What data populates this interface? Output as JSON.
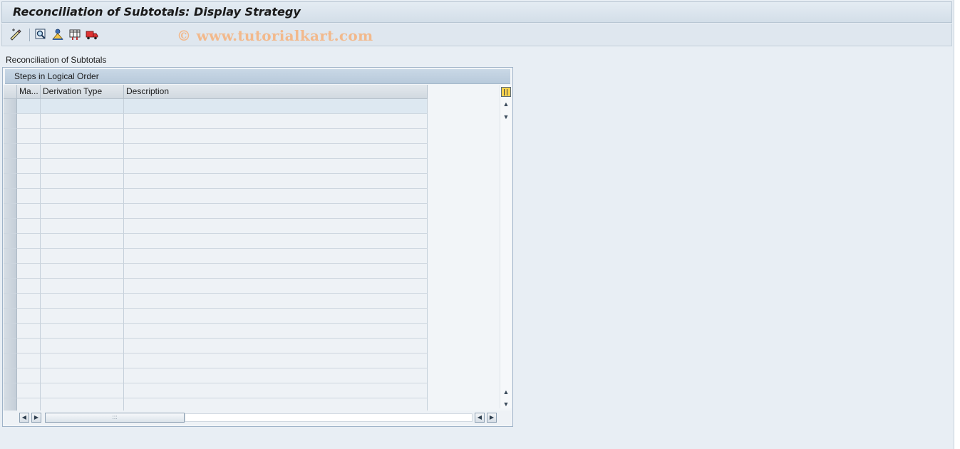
{
  "window": {
    "title": "Reconciliation of Subtotals: Display Strategy"
  },
  "toolbar": {
    "buttons": [
      {
        "name": "display-change-icon"
      },
      {
        "name": "find-icon"
      },
      {
        "name": "hierarchy-icon"
      },
      {
        "name": "overview-icon"
      },
      {
        "name": "transport-icon"
      }
    ]
  },
  "watermark": "© www.tutorialkart.com",
  "section": {
    "label": "Reconciliation of Subtotals"
  },
  "table": {
    "title": "Steps in Logical Order",
    "columns": [
      "Ma...",
      "Derivation Type",
      "Description"
    ],
    "rows": [
      [
        "",
        "",
        ""
      ],
      [
        "",
        "",
        ""
      ],
      [
        "",
        "",
        ""
      ],
      [
        "",
        "",
        ""
      ],
      [
        "",
        "",
        ""
      ],
      [
        "",
        "",
        ""
      ],
      [
        "",
        "",
        ""
      ],
      [
        "",
        "",
        ""
      ],
      [
        "",
        "",
        ""
      ],
      [
        "",
        "",
        ""
      ],
      [
        "",
        "",
        ""
      ],
      [
        "",
        "",
        ""
      ],
      [
        "",
        "",
        ""
      ],
      [
        "",
        "",
        ""
      ],
      [
        "",
        "",
        ""
      ],
      [
        "",
        "",
        ""
      ],
      [
        "",
        "",
        ""
      ],
      [
        "",
        "",
        ""
      ],
      [
        "",
        "",
        ""
      ],
      [
        "",
        "",
        ""
      ],
      [
        "",
        "",
        ""
      ]
    ],
    "colors": {
      "header_bg": "#d1d9e0",
      "title_bg": "#b8cadb",
      "selected_row": "#dde8f1"
    }
  }
}
